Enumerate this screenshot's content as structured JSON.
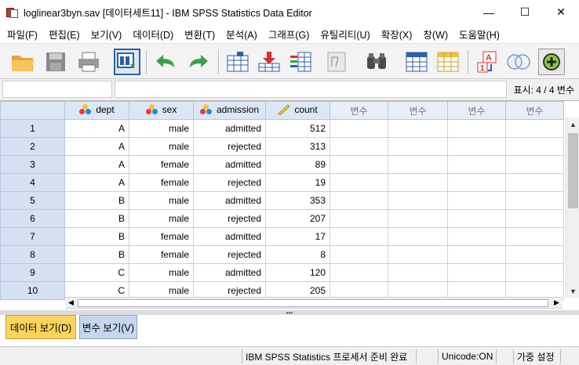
{
  "window": {
    "title": "loglinear3byn.sav [데이터세트11] - IBM SPSS Statistics Data Editor",
    "controls": {
      "minimize": "—",
      "maximize": "☐",
      "close": "✕"
    }
  },
  "menu": [
    "파일(F)",
    "편집(E)",
    "보기(V)",
    "데이터(D)",
    "변환(T)",
    "분석(A)",
    "그래프(G)",
    "유틸리티(U)",
    "확장(X)",
    "창(W)",
    "도움말(H)"
  ],
  "toolbar": {
    "icons": [
      "open-folder-icon",
      "save-icon",
      "print-icon",
      "recall-dialog-icon",
      "undo-icon",
      "redo-icon",
      "goto-case-icon",
      "goto-variable-icon",
      "variables-icon",
      "find-icon",
      "insert-cases-icon",
      "insert-variable-icon",
      "split-file-icon",
      "weight-cases-icon",
      "value-labels-icon",
      "use-sets-icon",
      "show-all-variables-icon"
    ]
  },
  "editrow": {
    "cell_ref": "",
    "cell_value": "",
    "show_count": "표시: 4 / 4 변수"
  },
  "grid": {
    "columns": [
      {
        "name": "dept",
        "icon": "nominal-icon"
      },
      {
        "name": "sex",
        "icon": "nominal-icon"
      },
      {
        "name": "admission",
        "icon": "nominal-icon"
      },
      {
        "name": "count",
        "icon": "scale-ruler-icon"
      }
    ],
    "empty_col_label": "변수",
    "rows": [
      {
        "n": "1",
        "dept": "A",
        "sex": "male",
        "admission": "admitted",
        "count": "512"
      },
      {
        "n": "2",
        "dept": "A",
        "sex": "male",
        "admission": "rejected",
        "count": "313"
      },
      {
        "n": "3",
        "dept": "A",
        "sex": "female",
        "admission": "admitted",
        "count": "89"
      },
      {
        "n": "4",
        "dept": "A",
        "sex": "female",
        "admission": "rejected",
        "count": "19"
      },
      {
        "n": "5",
        "dept": "B",
        "sex": "male",
        "admission": "admitted",
        "count": "353"
      },
      {
        "n": "6",
        "dept": "B",
        "sex": "male",
        "admission": "rejected",
        "count": "207"
      },
      {
        "n": "7",
        "dept": "B",
        "sex": "female",
        "admission": "admitted",
        "count": "17"
      },
      {
        "n": "8",
        "dept": "B",
        "sex": "female",
        "admission": "rejected",
        "count": "8"
      },
      {
        "n": "9",
        "dept": "C",
        "sex": "male",
        "admission": "admitted",
        "count": "120"
      },
      {
        "n": "10",
        "dept": "C",
        "sex": "male",
        "admission": "rejected",
        "count": "205"
      }
    ]
  },
  "tabs": {
    "data_view": "데이터 보기(D)",
    "variable_view": "변수 보기(V)"
  },
  "status": {
    "processor": "IBM SPSS Statistics 프로세서 준비 완료",
    "unicode": "Unicode:ON",
    "weight": "가중 설정"
  },
  "colors": {
    "accent": "#fcd45c",
    "header_blue": "#dce7f5",
    "tab_blue": "#c6d6ec"
  }
}
